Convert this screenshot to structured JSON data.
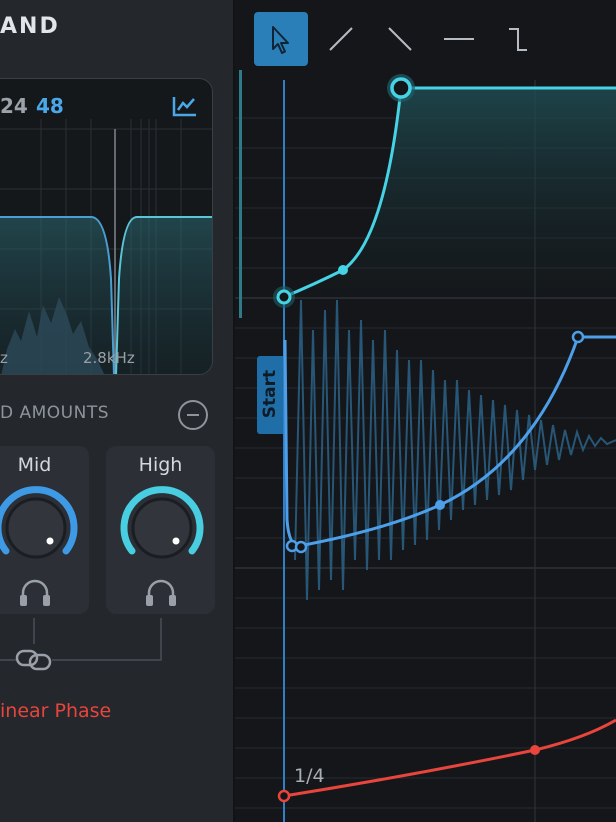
{
  "panel": {
    "title": "AND",
    "slopes": {
      "option_a": "24",
      "option_b": "48",
      "selected": "48"
    },
    "frequency_labels": [
      "z",
      "2.8kHz"
    ],
    "amounts_title": "D AMOUNTS",
    "bands": [
      {
        "label": "Mid",
        "level": 0.6
      },
      {
        "label": "High",
        "level": 0.6
      }
    ],
    "linear_phase_label": "inear Phase"
  },
  "editor": {
    "tools": [
      "pointer-tool",
      "rise-tool",
      "fall-tool",
      "flat-tool",
      "step-tool"
    ],
    "selected_tool": "pointer-tool",
    "start_label": "Start",
    "beat_label": "1/4"
  },
  "colors": {
    "accent": "#2b7fb8",
    "cyan_curve": "#47d3e6",
    "blue_curve": "#4c9fe8",
    "red_curve": "#e8453c",
    "panel_bg": "#24272c",
    "editor_bg": "#141619"
  }
}
